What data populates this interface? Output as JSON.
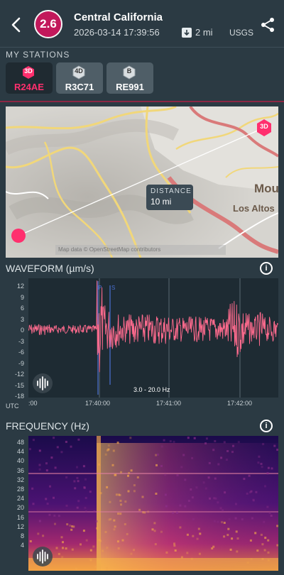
{
  "header": {
    "magnitude": "2.6",
    "title": "Central California",
    "datetime": "2026-03-14 17:39:56",
    "distance": "2 mi",
    "source": "USGS"
  },
  "stations": {
    "label": "MY STATIONS",
    "items": [
      {
        "badge": "3D",
        "code": "R24AE",
        "active": true
      },
      {
        "badge": "4D",
        "code": "R3C71",
        "active": false
      },
      {
        "badge": "B",
        "code": "RE991",
        "active": false
      }
    ]
  },
  "map": {
    "distance_label": "DISTANCE",
    "distance_value": "10 mi",
    "station_badge": "3D",
    "places": [
      "Mou",
      "Los Altos"
    ],
    "attribution": "Map data © OpenStreetMap contributors"
  },
  "waveform": {
    "title": "WAVEFORM (µm/s)",
    "y_ticks": [
      "12",
      "9",
      "6",
      "3",
      "0",
      "-3",
      "-6",
      "-9",
      "-12",
      "-15",
      "-18"
    ],
    "x_ticks": [
      ":00",
      "17:40:00",
      "17:41:00",
      "17:42:00"
    ],
    "utc_label": "UTC",
    "band": "3.0 - 20.0 Hz",
    "markers": [
      "P",
      "S"
    ]
  },
  "frequency": {
    "title": "FREQUENCY (Hz)",
    "y_ticks": [
      "48",
      "44",
      "40",
      "36",
      "32",
      "28",
      "24",
      "20",
      "16",
      "12",
      "8",
      "4"
    ]
  },
  "colors": {
    "accent": "#ff2f6e",
    "magnitude_bg": "#c2185b",
    "wave": "#ff6b8e"
  }
}
